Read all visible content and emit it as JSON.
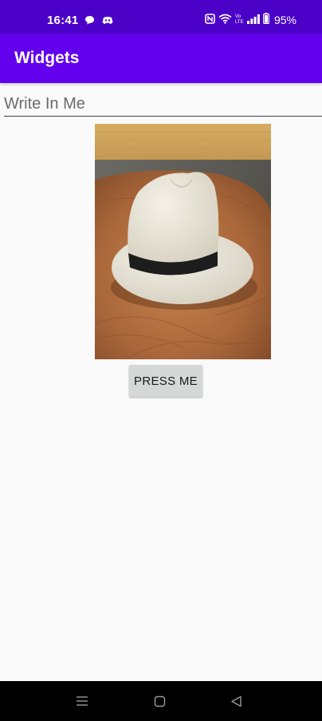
{
  "status_bar": {
    "time": "16:41",
    "battery": "95%",
    "icons": [
      "chat-bubble-icon",
      "discord-icon",
      "nfc-icon",
      "wifi-icon",
      "volte-icon",
      "signal-icon",
      "battery-icon"
    ],
    "background": "#4b00c8"
  },
  "app_bar": {
    "title": "Widgets",
    "background": "#6200ee"
  },
  "main": {
    "input": {
      "value": "",
      "placeholder": "Write In Me"
    },
    "image": {
      "subject": "white fedora hat on wooden table"
    },
    "button": {
      "label": "PRESS ME",
      "background": "#d6d7d7"
    }
  },
  "nav_bar": {
    "icons": [
      "menu-icon",
      "home-icon",
      "back-icon"
    ]
  }
}
